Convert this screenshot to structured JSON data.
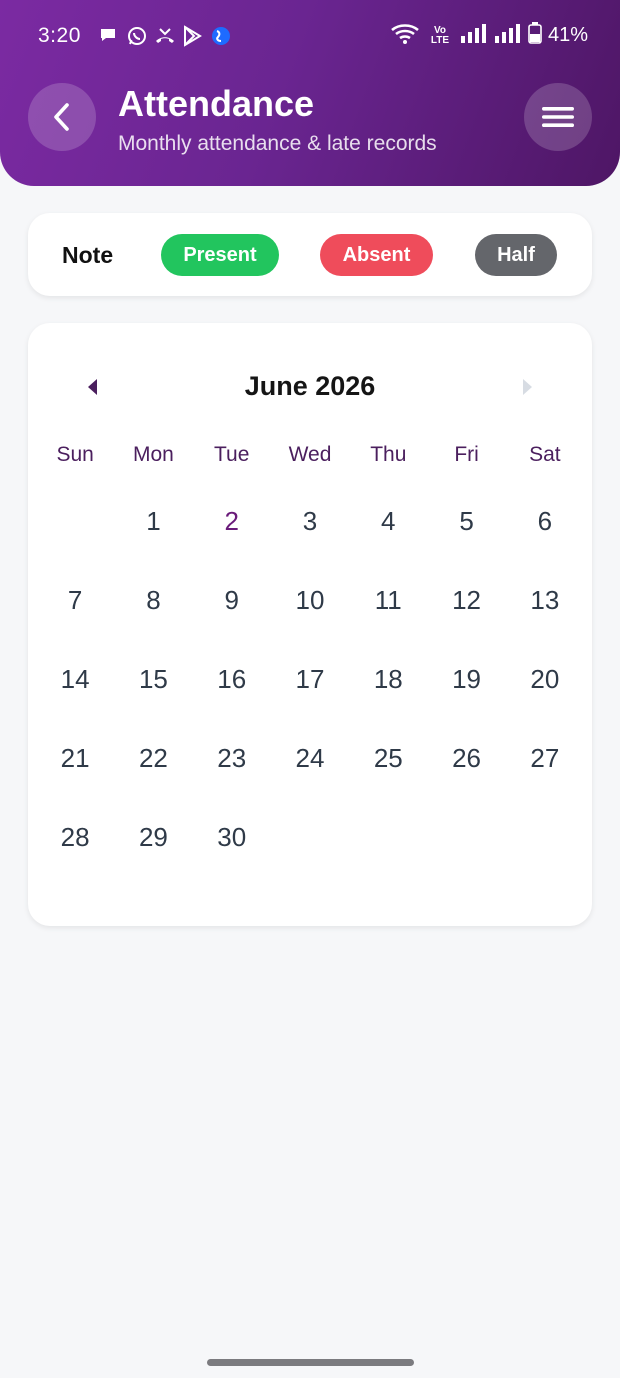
{
  "status_bar": {
    "time": "3:20",
    "battery": "41%",
    "volte_top": "Vo",
    "volte_bottom": "LTE"
  },
  "header": {
    "title": "Attendance",
    "subtitle": "Monthly attendance & late records"
  },
  "legend": {
    "label": "Note",
    "items": [
      {
        "label": "Present",
        "color": "#22c55e"
      },
      {
        "label": "Absent",
        "color": "#ef4c5b"
      },
      {
        "label": "Half",
        "color": "#64666b"
      }
    ]
  },
  "calendar": {
    "month_title": "June 2026",
    "weekdays": [
      "Sun",
      "Mon",
      "Tue",
      "Wed",
      "Thu",
      "Fri",
      "Sat"
    ],
    "leading_blanks": 1,
    "days": [
      "1",
      "2",
      "3",
      "4",
      "5",
      "6",
      "7",
      "8",
      "9",
      "10",
      "11",
      "12",
      "13",
      "14",
      "15",
      "16",
      "17",
      "18",
      "19",
      "20",
      "21",
      "22",
      "23",
      "24",
      "25",
      "26",
      "27",
      "28",
      "29",
      "30"
    ],
    "highlighted_day": "2"
  },
  "colors": {
    "header_gradient_start": "#7b2aa2",
    "header_gradient_end": "#4e1665",
    "accent": "#6a1b7a"
  }
}
